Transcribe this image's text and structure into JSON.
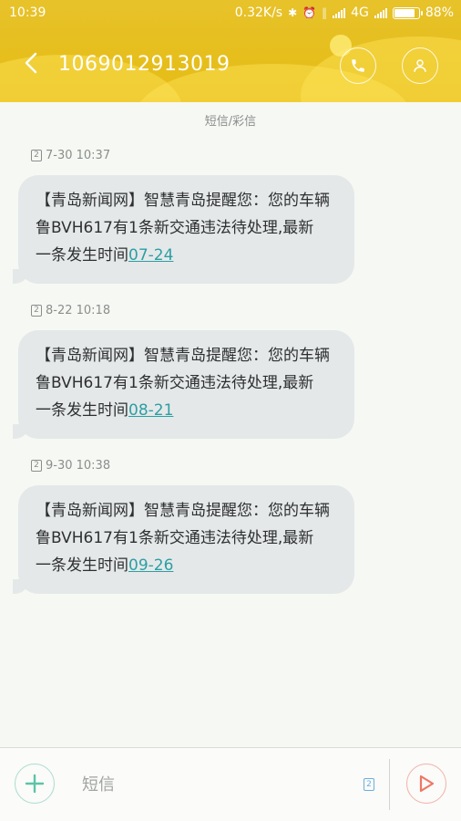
{
  "status_bar": {
    "time": "10:39",
    "net_speed": "0.32K/s",
    "network": "4G",
    "battery": "88%",
    "battery_level": 0.88
  },
  "header": {
    "contact": "1069012913019",
    "back_icon": "chevron-left-icon",
    "call_icon": "phone-icon",
    "contact_icon": "person-icon"
  },
  "conversation": {
    "type_label": "短信/彩信",
    "messages": [
      {
        "time": "7-30 10:37",
        "sim": "2",
        "line1": "【青岛新闻网】智慧青岛提醒您：您的车辆",
        "line2": "鲁BVH617有1条新交通违法待处理,最新",
        "line3_prefix": "一条发生时间",
        "date_link": "07-24"
      },
      {
        "time": "8-22 10:18",
        "sim": "2",
        "line1": "【青岛新闻网】智慧青岛提醒您：您的车辆",
        "line2": "鲁BVH617有1条新交通违法待处理,最新",
        "line3_prefix": "一条发生时间",
        "date_link": "08-21"
      },
      {
        "time": "9-30 10:38",
        "sim": "2",
        "line1": "【青岛新闻网】智慧青岛提醒您：您的车辆",
        "line2": "鲁BVH617有1条新交通违法待处理,最新",
        "line3_prefix": "一条发生时间",
        "date_link": "09-26"
      }
    ]
  },
  "input_bar": {
    "placeholder": "短信",
    "sim": "2",
    "add_icon": "plus-icon",
    "send_icon": "send-icon"
  },
  "colors": {
    "header": "#e6bf1d",
    "bubble": "#e5e8e9",
    "link": "#2c9fa3",
    "add_accent": "#5cc4a8",
    "send_accent": "#ee7766"
  }
}
